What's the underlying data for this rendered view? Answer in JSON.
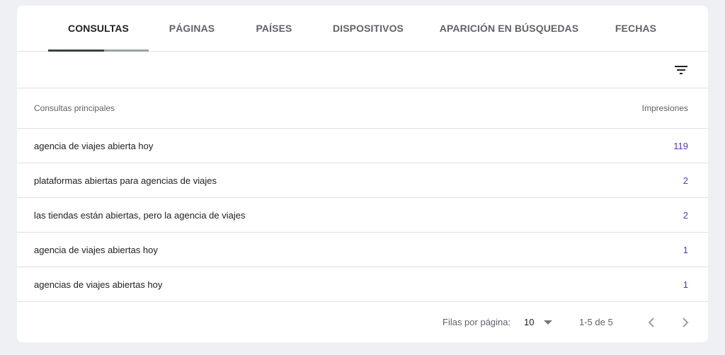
{
  "tabs": [
    {
      "label": "CONSULTAS"
    },
    {
      "label": "PÁGINAS"
    },
    {
      "label": "PAÍSES"
    },
    {
      "label": "DISPOSITIVOS"
    },
    {
      "label": "APARICIÓN EN BÚSQUEDAS"
    },
    {
      "label": "FECHAS"
    }
  ],
  "toolbar": {
    "filter_icon": "filter-list-icon"
  },
  "table": {
    "columns": {
      "query": "Consultas principales",
      "impressions": "Impresiones"
    },
    "rows": [
      {
        "query": "agencia de viajes abierta hoy",
        "impressions": "119"
      },
      {
        "query": "plataformas abiertas para agencias de viajes",
        "impressions": "2"
      },
      {
        "query": "las tiendas están abiertas, pero la agencia de viajes",
        "impressions": "2"
      },
      {
        "query": "agencia de viajes abiertas hoy",
        "impressions": "1"
      },
      {
        "query": "agencias de viajes abiertas hoy",
        "impressions": "1"
      }
    ]
  },
  "pagination": {
    "rows_per_page_label": "Filas por página:",
    "rows_per_page_value": "10",
    "range": "1-5 de 5"
  },
  "colors": {
    "accent_value": "#5e35b1",
    "active_tab": "#202124",
    "background": "#eef0f4"
  }
}
